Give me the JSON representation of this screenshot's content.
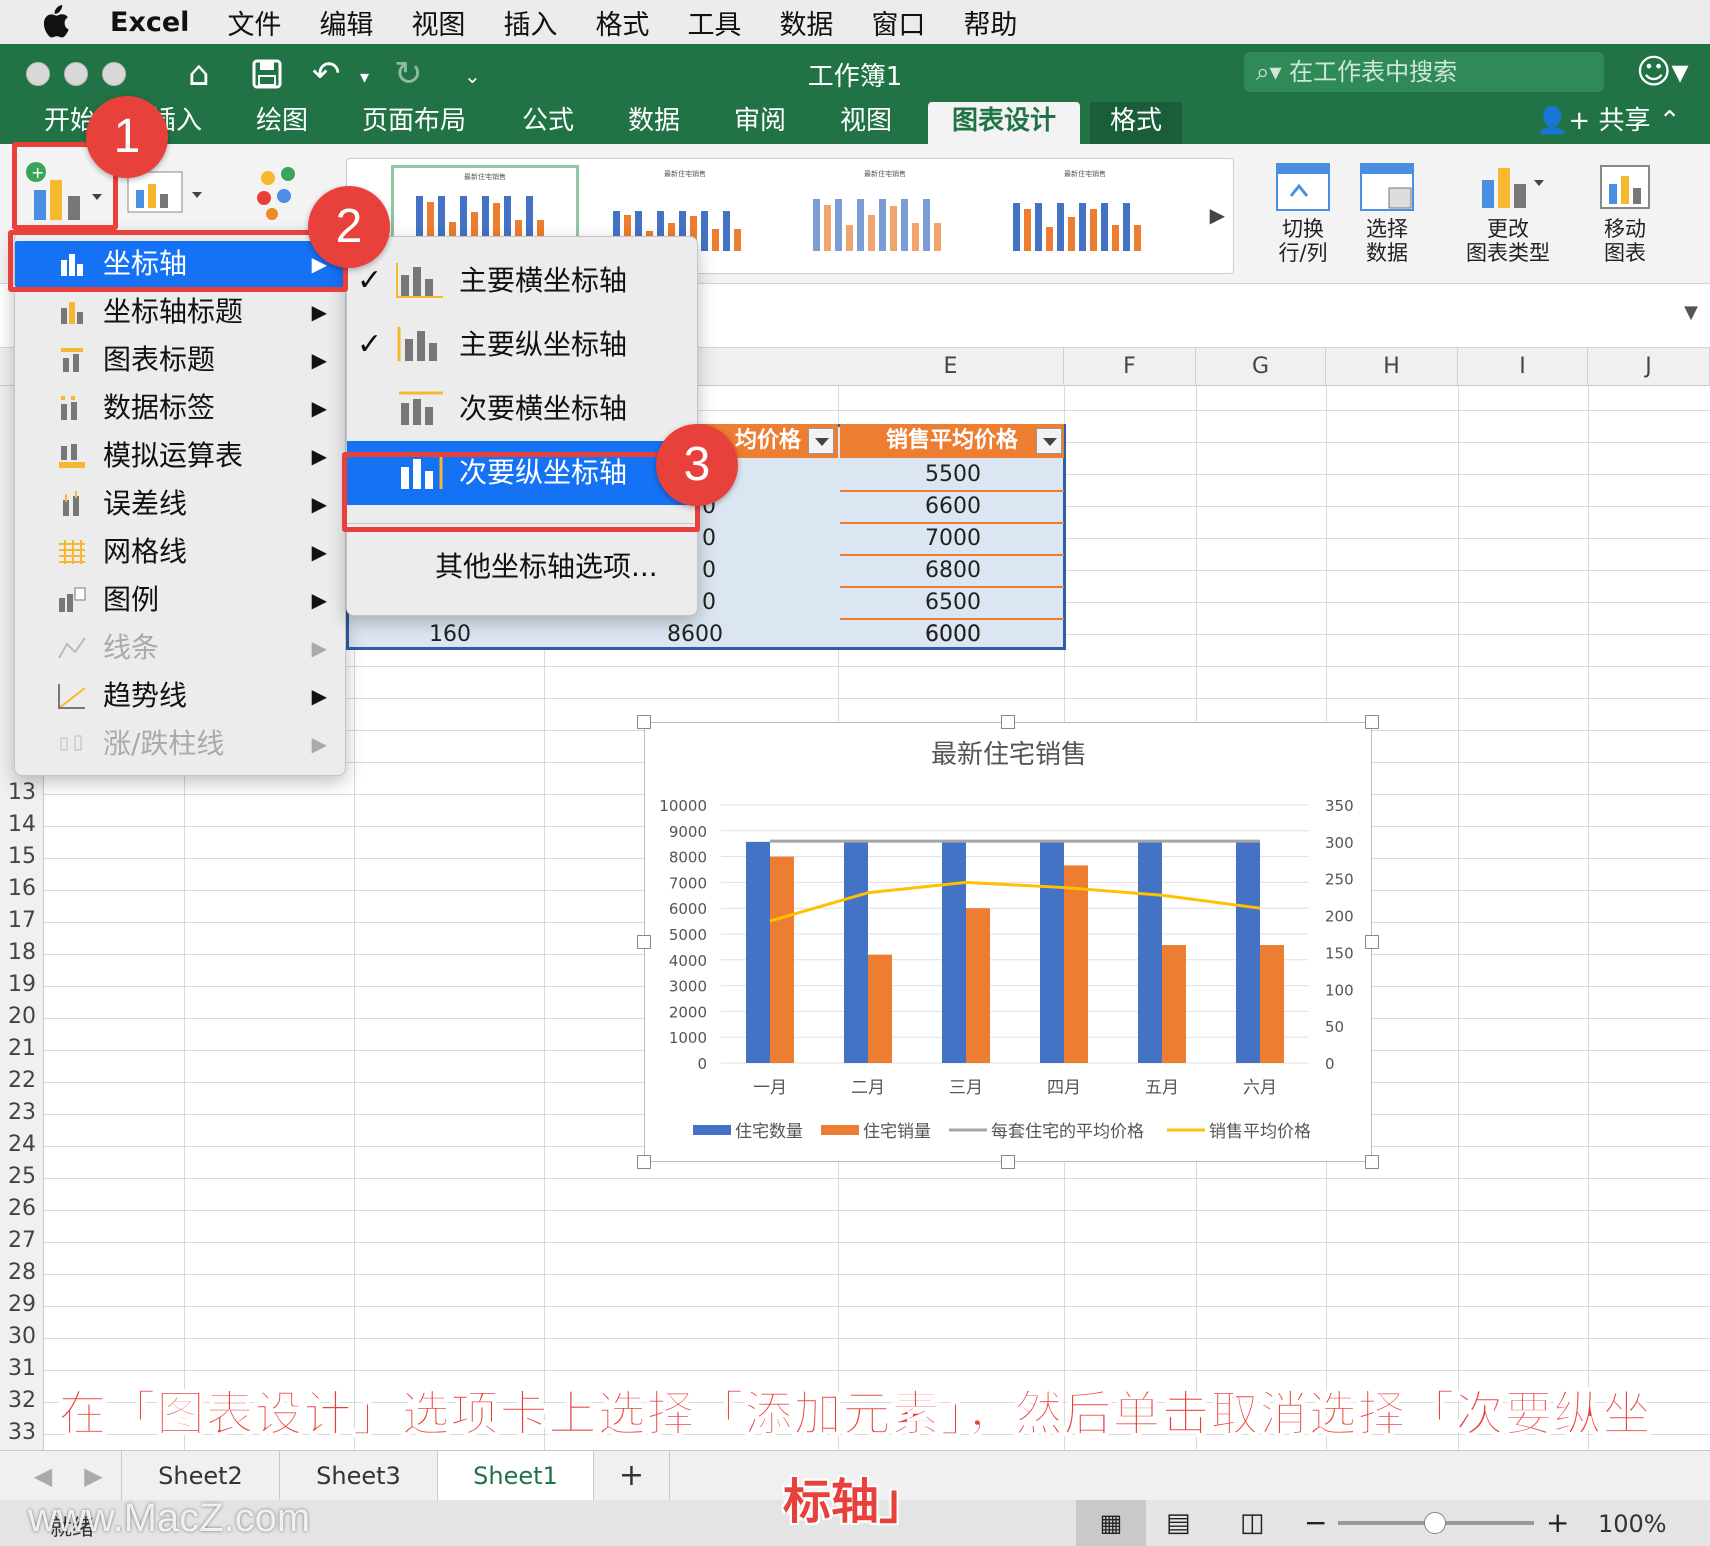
{
  "menubar": {
    "app": "Excel",
    "items": [
      "文件",
      "编辑",
      "视图",
      "插入",
      "格式",
      "工具",
      "数据",
      "窗口",
      "帮助"
    ]
  },
  "window": {
    "title": "工作簿1",
    "search_placeholder": "在工作表中搜索",
    "share": "共享"
  },
  "tabs": [
    "开始",
    "插入",
    "绘图",
    "页面布局",
    "公式",
    "数据",
    "审阅",
    "视图",
    "图表设计",
    "格式"
  ],
  "tabs_visible": {
    "home": "开始",
    "insert": "插入"
  },
  "ribbon": {
    "switch_rowcol": [
      "切换",
      "行/列"
    ],
    "select_data": [
      "选择",
      "数据"
    ],
    "change_type": [
      "更改",
      "图表类型"
    ],
    "move_chart": [
      "移动",
      "图表"
    ],
    "thumb_title": "最新住宅销售"
  },
  "columns": [
    "E",
    "F",
    "G",
    "H",
    "I",
    "J"
  ],
  "rows": [
    "13",
    "14",
    "15",
    "16",
    "17",
    "18",
    "19",
    "20",
    "21",
    "22",
    "23",
    "24",
    "25",
    "26",
    "27",
    "28",
    "29",
    "30",
    "31",
    "32",
    "33"
  ],
  "table": {
    "headers": [
      "均价格",
      "销售平均价格"
    ],
    "col_d_fragments": [
      "0",
      "0",
      "0",
      "0"
    ],
    "col_e": [
      "5500",
      "6600",
      "7000",
      "6800",
      "6500",
      "6000"
    ],
    "last_row": [
      "160",
      "8600",
      "6000"
    ]
  },
  "menu_primary": [
    {
      "label": "坐标轴",
      "state": "selected"
    },
    {
      "label": "坐标轴标题",
      "state": "normal"
    },
    {
      "label": "图表标题",
      "state": "normal"
    },
    {
      "label": "数据标签",
      "state": "normal"
    },
    {
      "label": "模拟运算表",
      "state": "normal"
    },
    {
      "label": "误差线",
      "state": "normal"
    },
    {
      "label": "网格线",
      "state": "normal"
    },
    {
      "label": "图例",
      "state": "normal"
    },
    {
      "label": "线条",
      "state": "disabled"
    },
    {
      "label": "趋势线",
      "state": "normal"
    },
    {
      "label": "涨/跌柱线",
      "state": "disabled"
    }
  ],
  "menu_axes": [
    {
      "label": "主要横坐标轴",
      "checked": true
    },
    {
      "label": "主要纵坐标轴",
      "checked": true
    },
    {
      "label": "次要横坐标轴",
      "checked": false
    },
    {
      "label": "次要纵坐标轴",
      "checked": true,
      "selected": true
    },
    {
      "label": "其他坐标轴选项..."
    }
  ],
  "badges": [
    "1",
    "2",
    "3"
  ],
  "sheets": [
    "Sheet2",
    "Sheet3",
    "Sheet1"
  ],
  "status": {
    "ready": "就绪",
    "zoom": "100%"
  },
  "caption": {
    "line1": "在「图表设计」选项卡上选择「添加元素」，然后单击取消选择「次要纵坐",
    "line2": "标轴」"
  },
  "watermark": "www.MacZ.com",
  "colors": {
    "excel_green": "#217346",
    "accent_blue": "#1572f5",
    "highlight_red": "#e8413c",
    "series_blue": "#4472c4",
    "series_orange": "#ed7d31",
    "series_gray": "#a5a5a5",
    "series_yellow": "#ffc000"
  },
  "chart_data": {
    "type": "bar",
    "title": "最新住宅销售",
    "categories": [
      "一月",
      "二月",
      "三月",
      "四月",
      "五月",
      "六月"
    ],
    "y_left_ticks": [
      "0",
      "1000",
      "2000",
      "3000",
      "4000",
      "5000",
      "6000",
      "7000",
      "8000",
      "9000",
      "10000"
    ],
    "y_right_ticks": [
      "0",
      "50",
      "100",
      "150",
      "200",
      "250",
      "300",
      "350"
    ],
    "ylim_left": [
      0,
      10000
    ],
    "ylim_right": [
      0,
      350
    ],
    "series": [
      {
        "name": "住宅数量",
        "kind": "bar",
        "axis": "right",
        "values": [
          300,
          300,
          300,
          300,
          300,
          300
        ]
      },
      {
        "name": "住宅销量",
        "kind": "bar",
        "axis": "right",
        "values": [
          280,
          147,
          210,
          268,
          160,
          160
        ]
      },
      {
        "name": "每套住宅的平均价格",
        "kind": "line",
        "axis": "left",
        "values": [
          8600,
          8600,
          8600,
          8600,
          8600,
          8600
        ]
      },
      {
        "name": "销售平均价格",
        "kind": "line",
        "axis": "left",
        "values": [
          5500,
          6600,
          7000,
          6800,
          6500,
          6000
        ]
      }
    ],
    "legend": "bottom",
    "grid": true
  }
}
